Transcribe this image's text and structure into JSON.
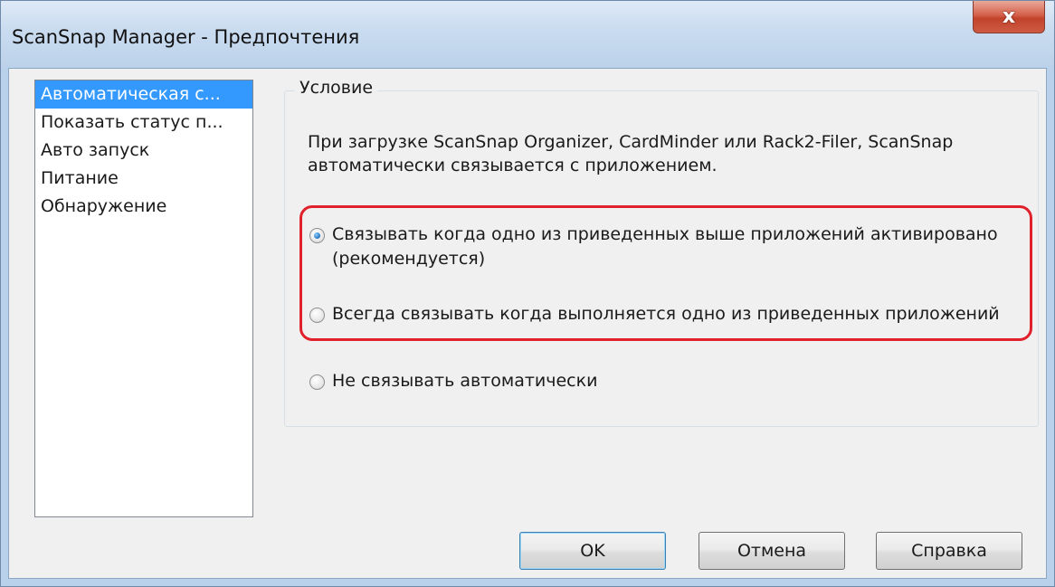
{
  "window": {
    "title": "ScanSnap Manager - Предпочтения",
    "close_label": "x"
  },
  "nav": {
    "items": [
      {
        "label": "Автоматическая с...",
        "selected": true
      },
      {
        "label": "Показать статус п...",
        "selected": false
      },
      {
        "label": "Авто запуск",
        "selected": false
      },
      {
        "label": "Питание",
        "selected": false
      },
      {
        "label": "Обнаружение",
        "selected": false
      }
    ]
  },
  "condition": {
    "legend": "Условие",
    "description": "При загрузке ScanSnap Organizer, CardMinder или Rack2-Filer, ScanSnap автоматически связывается с приложением.",
    "options": [
      {
        "label": "Связывать когда одно из приведенных выше приложений активировано (рекомендуется)",
        "checked": true
      },
      {
        "label": "Всегда связывать когда выполняется одно из приведенных приложений",
        "checked": false
      },
      {
        "label": "Не связывать автоматически",
        "checked": false
      }
    ]
  },
  "buttons": {
    "ok": "OK",
    "cancel": "Отмена",
    "help": "Справка"
  },
  "colors": {
    "highlight": "#e0202a",
    "selection": "#3399ff"
  }
}
